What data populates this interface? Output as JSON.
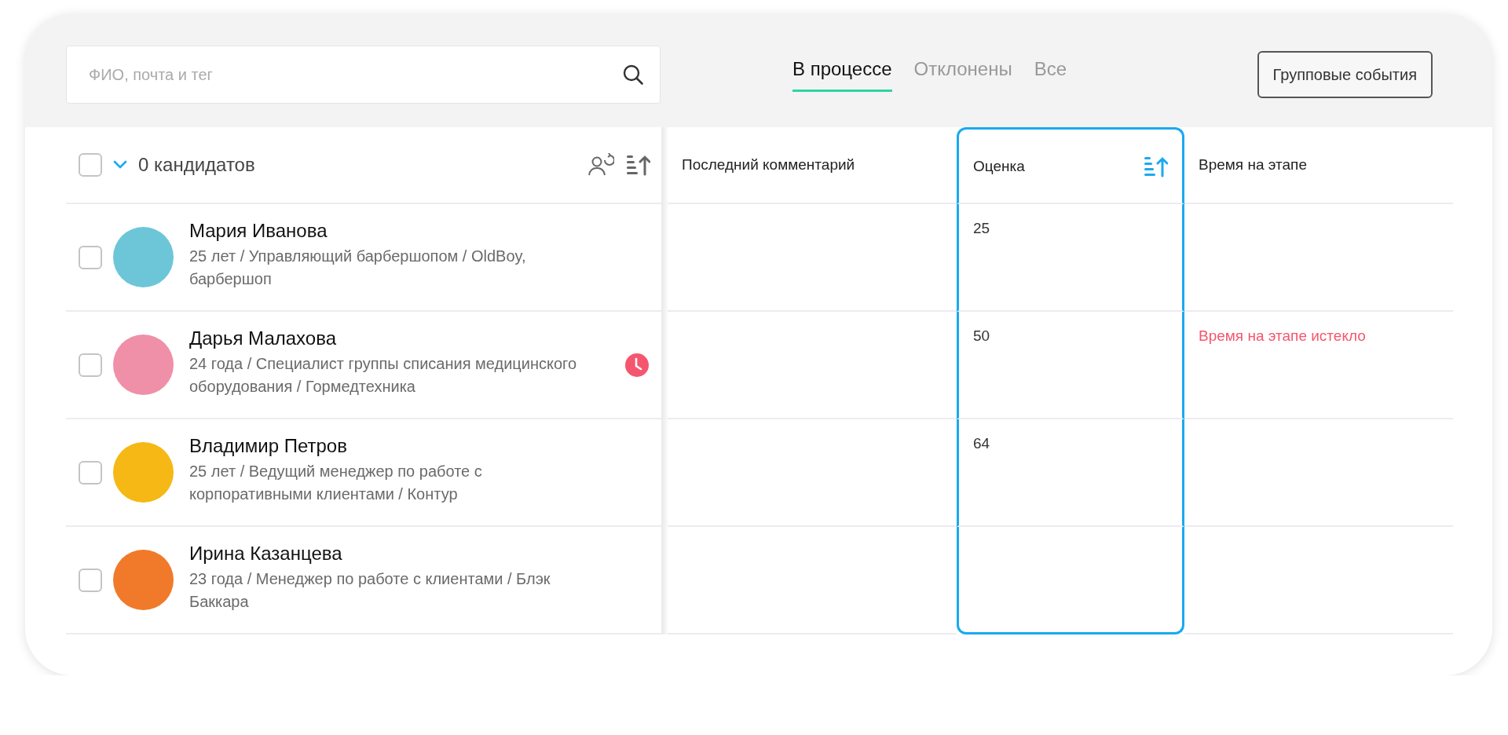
{
  "search": {
    "placeholder": "ФИО, почта и тег"
  },
  "tabs": [
    {
      "label": "В процессе",
      "selected": true
    },
    {
      "label": "Отклонены",
      "selected": false
    },
    {
      "label": "Все",
      "selected": false
    }
  ],
  "group_events_button": "Групповые события",
  "candidates_header": {
    "checked": false,
    "count": "0 кандидатов"
  },
  "columns": [
    {
      "label": "Последний комментарий",
      "selected": false
    },
    {
      "label": "Оценка",
      "selected": true
    },
    {
      "label": "Время на этапе",
      "selected": false
    }
  ],
  "candidates": [
    {
      "name": "Мария Иванова",
      "details": "25 лет / Управляющий барбершопом / OldBoy, барбершоп",
      "checked": false,
      "color": "#6cc6d8",
      "overdue": false,
      "score": "25"
    },
    {
      "name": "Дарья Малахова",
      "details": "24 года / Специалист группы списания медицинского оборудования / Гормедтехника",
      "checked": false,
      "color": "#f08fa8",
      "overdue": true,
      "score": "50",
      "stage_time": "Время на этапе истекло"
    },
    {
      "name": "Владимир Петров",
      "details": "25 лет / Ведущий менеджер по работе с корпоративными клиентами / Контур",
      "checked": false,
      "color": "#f5b814",
      "overdue": false,
      "score": "64"
    },
    {
      "name": "Ирина Казанцева",
      "details": "23 года / Менеджер по работе с клиентами / Блэк Баккара",
      "checked": false,
      "color": "#f07a2a",
      "overdue": false
    }
  ]
}
